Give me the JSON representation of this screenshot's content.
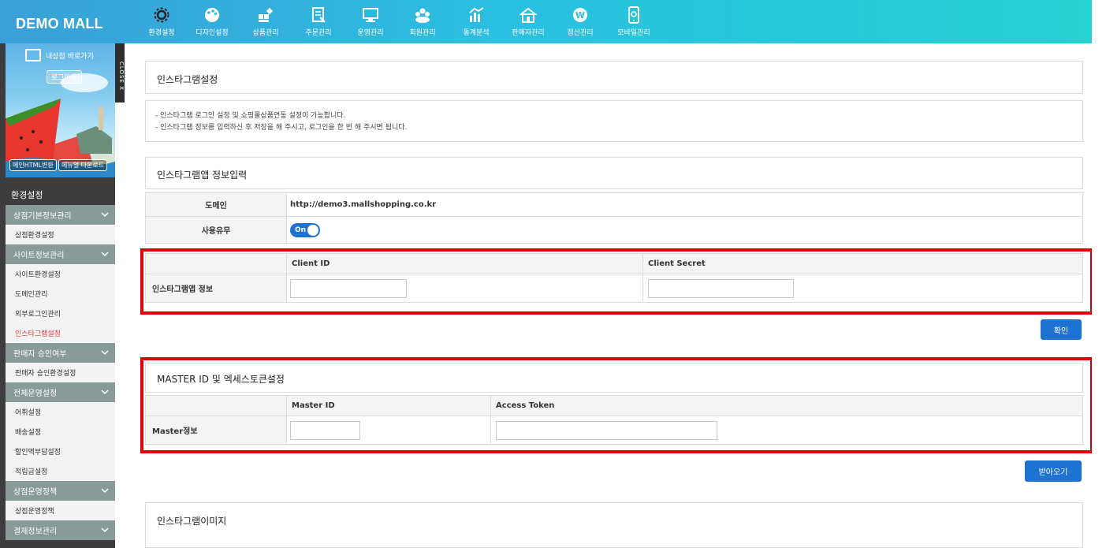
{
  "app": {
    "logo": "DEMO MALL"
  },
  "nav": [
    {
      "label": "환경설정",
      "icon": "gear-icon"
    },
    {
      "label": "디자인설정",
      "icon": "palette-icon"
    },
    {
      "label": "상품관리",
      "icon": "products-icon"
    },
    {
      "label": "주문관리",
      "icon": "order-icon"
    },
    {
      "label": "운영관리",
      "icon": "monitor-icon"
    },
    {
      "label": "회원관리",
      "icon": "members-icon"
    },
    {
      "label": "통계분석",
      "icon": "stats-icon"
    },
    {
      "label": "판매자관리",
      "icon": "seller-icon"
    },
    {
      "label": "정산관리",
      "icon": "settlement-icon"
    },
    {
      "label": "모바일관리",
      "icon": "mobile-icon"
    }
  ],
  "sidebar": {
    "shop_link": "내상점 바로가기",
    "logout": "로그아웃",
    "close_tab": "CLOSE X",
    "btn_html": "메인HTML변환",
    "btn_manual": "메뉴얼 다운로드",
    "section_title": "환경설정",
    "menu": [
      {
        "type": "group",
        "label": "상점기본정보관리"
      },
      {
        "type": "sub",
        "label": "상점환경설정"
      },
      {
        "type": "group",
        "label": "사이트정보관리"
      },
      {
        "type": "sub",
        "label": "사이트환경설정"
      },
      {
        "type": "sub",
        "label": "도메인관리"
      },
      {
        "type": "sub",
        "label": "외부로그인관리"
      },
      {
        "type": "sub",
        "label": "인스타그램설정",
        "active": true
      },
      {
        "type": "group",
        "label": "판매자 승인여부"
      },
      {
        "type": "sub",
        "label": "판매자 승인환경설정"
      },
      {
        "type": "group",
        "label": "전체운영설정"
      },
      {
        "type": "sub",
        "label": "어휘설정"
      },
      {
        "type": "sub",
        "label": "배송설정"
      },
      {
        "type": "sub",
        "label": "할인액부담설정"
      },
      {
        "type": "sub",
        "label": "적립금설정"
      },
      {
        "type": "group",
        "label": "상점운영정책"
      },
      {
        "type": "sub",
        "label": "상점운영정책"
      },
      {
        "type": "group",
        "label": "결제정보관리"
      }
    ]
  },
  "page": {
    "title": "인스타그램설정",
    "notice": [
      "- 인스타그램 로그인 설정 및 쇼핑몰상품연동 설정이 가능합니다.",
      "- 인스타그램 정보를 입력하신 후 저장을 해 주시고, 로그인을 한 번 해 주시면 됩니다."
    ],
    "app_info_title": "인스타그램앱 정보입력",
    "domain_label": "도메인",
    "domain_value": "http://demo3.mallshopping.co.kr",
    "use_label": "사용유무",
    "use_toggle": "On",
    "client_id_header": "Client ID",
    "client_secret_header": "Client Secret",
    "app_info_label": "인스타그램앱 정보",
    "confirm_button": "확인",
    "master_title": "MASTER ID 및 엑세스토큰설정",
    "master_id_header": "Master ID",
    "access_token_header": "Access Token",
    "master_label": "Master정보",
    "fetch_button": "받아오기",
    "image_title": "인스타그램이미지"
  }
}
